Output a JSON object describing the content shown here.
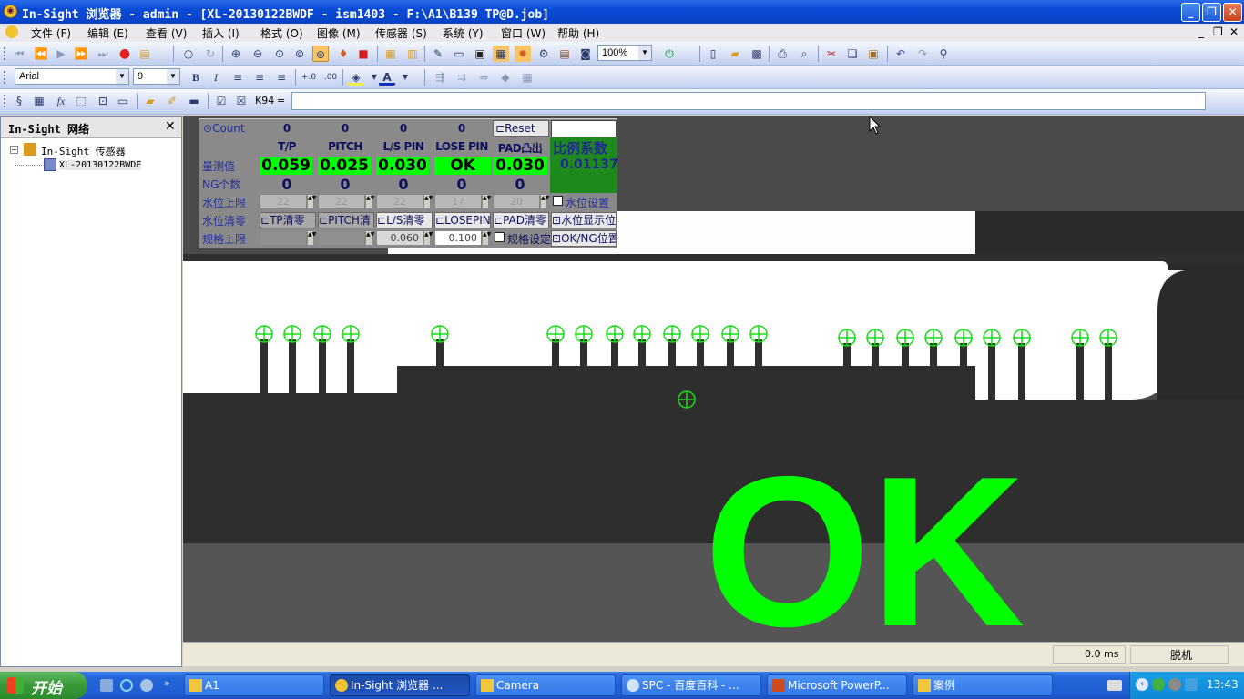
{
  "window": {
    "title": "In-Sight 浏览器 - admin - [XL-20130122BWDF - ism1403 - F:\\A1\\B139 TP@D.job]"
  },
  "menu": [
    "文件 (F)",
    "编辑 (E)",
    "查看 (V)",
    "插入 (I)",
    "格式 (O)",
    "图像 (M)",
    "传感器 (S)",
    "系统 (Y)",
    "窗口 (W)",
    "帮助 (H)"
  ],
  "toolbar": {
    "zoom": "100%",
    "font_name": "Arial",
    "font_size": "9",
    "cell_ref": "K94",
    "equals": "="
  },
  "panel": {
    "title": "In-Sight 网络",
    "tree_root": "In-Sight 传感器",
    "tree_child": "XL-20130122BWDF"
  },
  "ng_panel": {
    "count_label": "Count",
    "counts": [
      "0",
      "0",
      "0",
      "0"
    ],
    "reset_label": "Reset",
    "headers": [
      "T/P",
      "PITCH",
      "L/S PIN",
      "LOSE PIN",
      "PAD凸出"
    ],
    "ratio_label": "比例系数",
    "ratio_value": "0.01137",
    "meas_label": "量测值",
    "measurements": [
      "0.059",
      "0.025",
      "0.030",
      "OK",
      "0.030"
    ],
    "ng_label": "NG个数",
    "ng_counts": [
      "0",
      "0",
      "0",
      "0",
      "0"
    ],
    "water_upper_label": "水位上限",
    "water_upper_values": [
      "22",
      "22",
      "22",
      "17",
      "20"
    ],
    "water_setting_label": "水位设置",
    "water_clear_label": "水位清零",
    "clear_buttons": [
      "TP清零",
      "PITCH清",
      "L/S清零",
      "LOSEPIN",
      "PAD清零"
    ],
    "water_display_label": "水位显示位",
    "spec_upper_label": "规格上限",
    "spec_values": [
      "",
      "",
      "0.060",
      "0.100"
    ],
    "spec_setting_label": "规格设定",
    "okng_label": "OK/NG位置"
  },
  "result": {
    "text": "OK",
    "color": "#00ff00"
  },
  "status": {
    "time": "0.0 ms",
    "mode": "脱机"
  },
  "taskbar": {
    "start": "开始",
    "tasks": [
      "A1",
      "In-Sight 浏览器 ...",
      "Camera",
      "SPC - 百度百科 - ...",
      "Microsoft PowerP...",
      "案例"
    ],
    "clock": "13:43"
  },
  "colors": {
    "accent": "#0a4bd6",
    "pass": "#00ff00",
    "panel_bg": "#8a8a8a",
    "label_text": "#2430a0"
  }
}
